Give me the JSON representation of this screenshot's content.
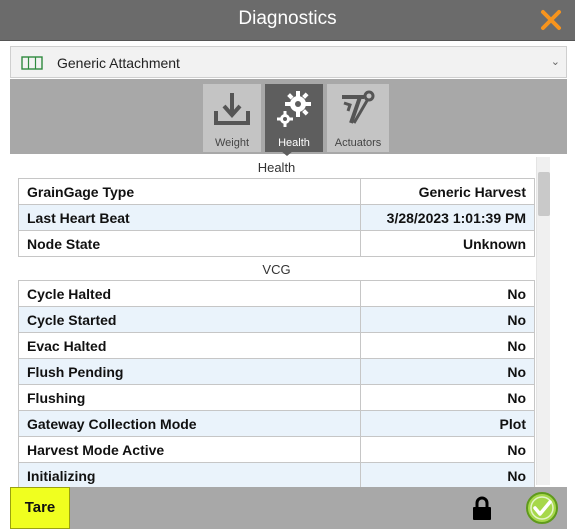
{
  "window": {
    "title": "Diagnostics"
  },
  "device_selector": {
    "value": "Generic Attachment"
  },
  "tabs": [
    {
      "label": "Weight",
      "icon": "weight-download-icon"
    },
    {
      "label": "Health",
      "icon": "gears-icon",
      "selected": true
    },
    {
      "label": "Actuators",
      "icon": "actuator-arm-icon"
    }
  ],
  "health": {
    "title": "Health",
    "rows": [
      {
        "key": "GrainGage Type",
        "value": "Generic Harvest"
      },
      {
        "key": "Last Heart Beat",
        "value": "3/28/2023 1:01:39 PM"
      },
      {
        "key": "Node State",
        "value": "Unknown"
      }
    ]
  },
  "vcg": {
    "title": "VCG",
    "rows": [
      {
        "key": "Cycle Halted",
        "value": "No"
      },
      {
        "key": "Cycle Started",
        "value": "No"
      },
      {
        "key": "Evac Halted",
        "value": "No"
      },
      {
        "key": "Flush Pending",
        "value": "No"
      },
      {
        "key": "Flushing",
        "value": "No"
      },
      {
        "key": "Gateway Collection Mode",
        "value": "Plot"
      },
      {
        "key": "Harvest Mode Active",
        "value": "No"
      },
      {
        "key": "Initializing",
        "value": "No"
      }
    ]
  },
  "bottom": {
    "tare_label": "Tare"
  },
  "colors": {
    "accent_orange": "#f7941d",
    "tare_yellow": "#f0ff1f",
    "ok_green": "#8ccf2e"
  }
}
